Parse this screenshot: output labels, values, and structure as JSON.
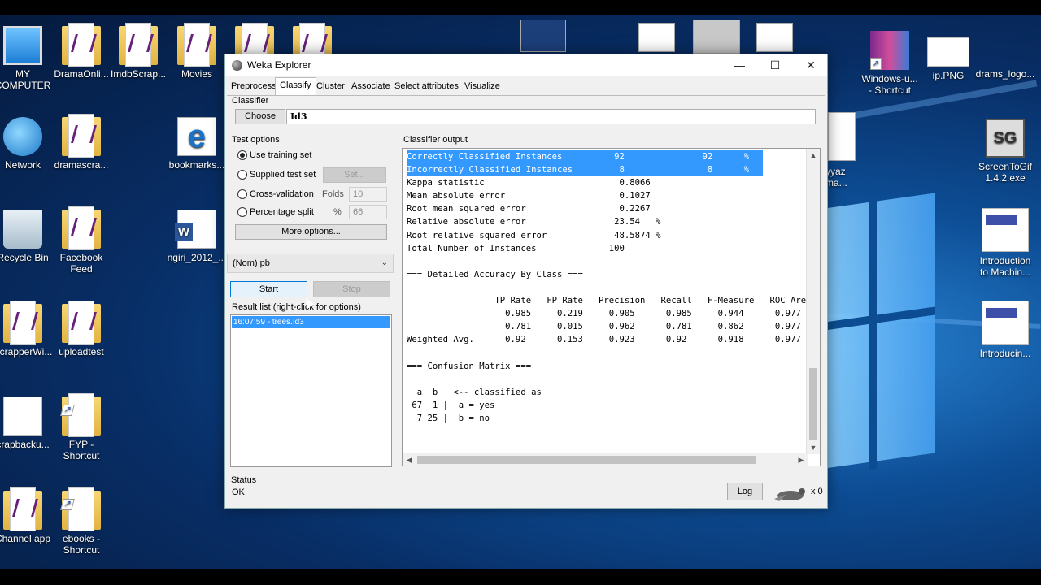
{
  "desktop": {
    "icons_left": [
      {
        "label": "MY COMPUTER",
        "icon": "computer-icon"
      },
      {
        "label": "Network",
        "icon": "network-icon"
      },
      {
        "label": "Recycle Bin",
        "icon": "recycle-bin-icon"
      },
      {
        "label": "ScrapperWi...",
        "icon": "folder-icon"
      },
      {
        "label": "crapbacku...",
        "icon": "file-icon"
      },
      {
        "label": "Channel app",
        "icon": "folder-icon"
      }
    ],
    "icons_col2": [
      {
        "label": "DramaOnli...",
        "icon": "vs-folder-icon"
      },
      {
        "label": "dramascra...",
        "icon": "vs-folder-icon"
      },
      {
        "label": "Facebook Feed",
        "icon": "folder-icon"
      },
      {
        "label": "uploadtest",
        "icon": "vs-folder-icon"
      },
      {
        "label": "FYP - Shortcut",
        "icon": "folder-shortcut-icon"
      },
      {
        "label": "ebooks - Shortcut",
        "icon": "folder-shortcut-icon"
      }
    ],
    "icons_col3": [
      {
        "label": "ImdbScrap...",
        "icon": "vs-folder-icon"
      },
      {
        "label": "Movies",
        "icon": "vs-folder-icon"
      },
      {
        "label": "bookmarks...",
        "icon": "edge-icon"
      },
      {
        "label": "ngiri_2012_...",
        "icon": "word-icon"
      }
    ],
    "icons_right": [
      {
        "label": "Windows-u... - Shortcut",
        "icon": "winrar-icon"
      },
      {
        "label": "ip.PNG",
        "icon": "image-icon"
      },
      {
        "label": "drams_logo...",
        "icon": "image-icon"
      },
      {
        "label": "ScreenToGif 1.4.2.exe",
        "icon": "screentogif-icon"
      },
      {
        "label": "Introduction to Machin...",
        "icon": "slides-icon"
      },
      {
        "label": "Introducin...",
        "icon": "slides-icon"
      },
      {
        "label": "yyaz ma...",
        "icon": "file-icon"
      }
    ],
    "screentogif_glyph": "SG"
  },
  "window": {
    "title": "Weka Explorer",
    "controls": {
      "minimize": "—",
      "maximize": "☐",
      "close": "✕"
    },
    "tabs": [
      "Preprocess",
      "Classify",
      "Cluster",
      "Associate",
      "Select attributes",
      "Visualize"
    ],
    "active_tab": "Classify",
    "classifier": {
      "group_label": "Classifier",
      "choose_label": "Choose",
      "value": "Id3"
    },
    "test_options": {
      "group_label": "Test options",
      "options": [
        "Use training set",
        "Supplied test set",
        "Cross-validation",
        "Percentage split"
      ],
      "selected": "Use training set",
      "set_label": "Set...",
      "folds_label": "Folds",
      "folds_value": "10",
      "percent_label": "%",
      "percent_value": "66",
      "more_options_label": "More options..."
    },
    "class_attribute": "(Nom) pb",
    "start_label": "Start",
    "stop_label": "Stop",
    "result_list": {
      "label": "Result list (right-click for options)",
      "items": [
        "16:07:59 - trees.Id3"
      ]
    },
    "output": {
      "label": "Classifier output",
      "lines": [
        "Correctly Classified Instances          92               92      %",
        "Incorrectly Classified Instances         8                8      %",
        "Kappa statistic                          0.8066",
        "Mean absolute error                      0.1027",
        "Root mean squared error                  0.2267",
        "Relative absolute error                 23.54   %",
        "Root relative squared error             48.5874 %",
        "Total Number of Instances              100",
        "",
        "=== Detailed Accuracy By Class ===",
        "",
        "                 TP Rate   FP Rate   Precision   Recall   F-Measure   ROC Area",
        "                   0.985     0.219     0.905      0.985     0.944      0.977",
        "                   0.781     0.015     0.962      0.781     0.862      0.977",
        "Weighted Avg.      0.92      0.153     0.923      0.92      0.918      0.977",
        "",
        "=== Confusion Matrix ===",
        "",
        "  a  b   <-- classified as",
        " 67  1 |  a = yes",
        "  7 25 |  b = no"
      ],
      "highlighted_lines": 2
    },
    "status": {
      "label": "Status",
      "text": "OK",
      "log_label": "Log",
      "count": "x 0"
    }
  }
}
